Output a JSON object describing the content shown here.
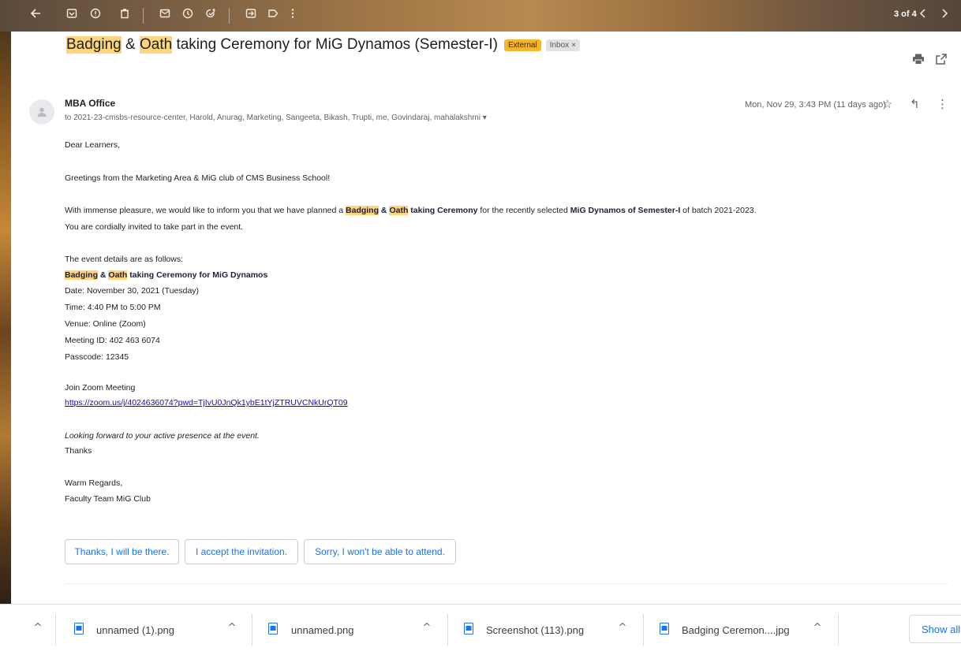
{
  "toolbar": {
    "counter": "3 of 4",
    "icons": [
      "back-arrow-icon",
      "archive-icon",
      "report-spam-icon",
      "delete-icon",
      "mark-unread-icon",
      "snooze-icon",
      "add-to-tasks-icon",
      "move-to-icon",
      "label-icon",
      "more-vert-icon",
      "newer-chevron-icon",
      "older-chevron-icon"
    ]
  },
  "subject": {
    "part1": "Badging",
    "part2": " & ",
    "part3": "Oath",
    "part4": " taking Ceremony for MiG Dynamos (Semester-I)",
    "label_external": "External",
    "label_inbox": "Inbox",
    "label_inbox_close": "×"
  },
  "message": {
    "sender": "MBA Office",
    "recipients": "to 2021-23-cmsbs-resource-center, Harold, Anurag, Marketing, Sangeeta, Bikash, Trupti, me, Govindaraj, mahalakshmi ▾",
    "date": "Mon, Nov 29, 3:43 PM (11 days ago)",
    "star": "☆",
    "reply": "↰",
    "more": "⋮"
  },
  "body": {
    "greeting": "Dear Learners,",
    "intro": "Greetings from the Marketing Area & MiG club of CMS Business School!",
    "p1_a": "With immense pleasure, we would like to inform you that we have planned a ",
    "p1_b1": "Badging",
    "p1_b2": " & ",
    "p1_b3": "Oath",
    "p1_b4": " taking Ceremony",
    "p1_c": " for the recently selected ",
    "p1_d": "MiG Dynamos of Semester-I",
    "p1_e": " of batch 2021-2023.",
    "p2": "You are cordially invited to take part in the event.",
    "details_intro": "The event details are as follows:",
    "event_b1": "Badging",
    "event_b2": " & ",
    "event_b3": "Oath",
    "event_b4": " taking Ceremony for MiG Dynamos",
    "date": "Date: November 30, 2021 (Tuesday)",
    "time": "Time: 4:40 PM to 5:00 PM",
    "venue": "Venue: Online (Zoom)",
    "meeting_id": "Meeting ID: 402 463 6074",
    "passcode": "Passcode: 12345",
    "join": "Join Zoom Meeting",
    "link": "https://zoom.us/j/4024636074?pwd=TjIvU0JnQk1ybE1tYjZTRUVCNkUrQT09",
    "closing_italic": "Looking forward to your active presence at the event.",
    "thanks": "Thanks",
    "regards": "Warm Regards,",
    "signature": "Faculty Team MiG Club"
  },
  "smart_replies": [
    "Thanks, I will be there.",
    "I accept the invitation.",
    "Sorry, I won't be able to attend."
  ],
  "downloads": {
    "files": [
      "unnamed (1).png",
      "unnamed.png",
      "Screenshot (113).png",
      "Badging Ceremon....jpg"
    ],
    "chevron": "^",
    "show_all": "Show all"
  }
}
